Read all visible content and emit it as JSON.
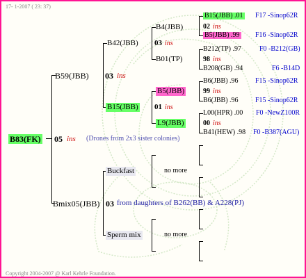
{
  "header": {
    "date_text": "17-  1-2007 ( 23: 37)"
  },
  "footer": {
    "copyright": "Copyright 2004-2007 @ Karl Kehrle Foundation."
  },
  "colors": {
    "border": "#ff1493",
    "green_highlight": "#66ff66",
    "pink_highlight": "#ff66cc",
    "gray_highlight": "#e8e8f0",
    "ins_color": "#cc0000",
    "link_color": "#0000cc"
  },
  "root": {
    "label": "B83(FK)",
    "year": "05",
    "ins": "ins",
    "note": "(Drones from 2x3 sister colonies)"
  },
  "gen1": {
    "dam": {
      "label": "B59(JBB)",
      "year": "03",
      "ins": "ins"
    },
    "sire": {
      "label": "Bmix05(JBB)",
      "year": "03",
      "note": "from daughters of B262(BB) & A228(PJ)"
    }
  },
  "gen2": {
    "b42": {
      "label": "B42(JBB)",
      "year": "03",
      "ins": "ins"
    },
    "b15": {
      "label": "B15(JBB)",
      "year": "01",
      "ins": "ins"
    },
    "buckfast": {
      "label": "Buckfast",
      "more": "no more"
    },
    "sperm": {
      "label": "Sperm mix",
      "more": "no more"
    }
  },
  "gen3": {
    "b4": {
      "label": "B4(JBB)",
      "year": "02",
      "ins": "ins"
    },
    "b01": {
      "label": "B01(TP)",
      "year": "98",
      "ins": "ins"
    },
    "b5": {
      "label": "B5(JBB)",
      "year": "99",
      "ins": "ins"
    },
    "l9": {
      "label": "L9(JBB)",
      "year": "00",
      "ins": "ins"
    }
  },
  "gen4": [
    {
      "label": "B15(JBB) .01",
      "link": "F17 -Sinop62R"
    },
    {
      "label": "B5(JBB) .99",
      "link": "F16 -Sinop62R"
    },
    {
      "label": "B212(TP) .97",
      "link": "F0 -B212(GB)"
    },
    {
      "label": "B208(GB) .94",
      "link": "F6 -B14D"
    },
    {
      "label": "B6(JBB) .96",
      "link": "F15 -Sinop62R"
    },
    {
      "label": "B6(JBB) .96",
      "link": "F15 -Sinop62R"
    },
    {
      "label": "L00(HPR) .00",
      "link": "F0 -NewZ100R"
    },
    {
      "label": "B41(HEW) .98",
      "link": "F0 -B387(AGU)"
    }
  ]
}
